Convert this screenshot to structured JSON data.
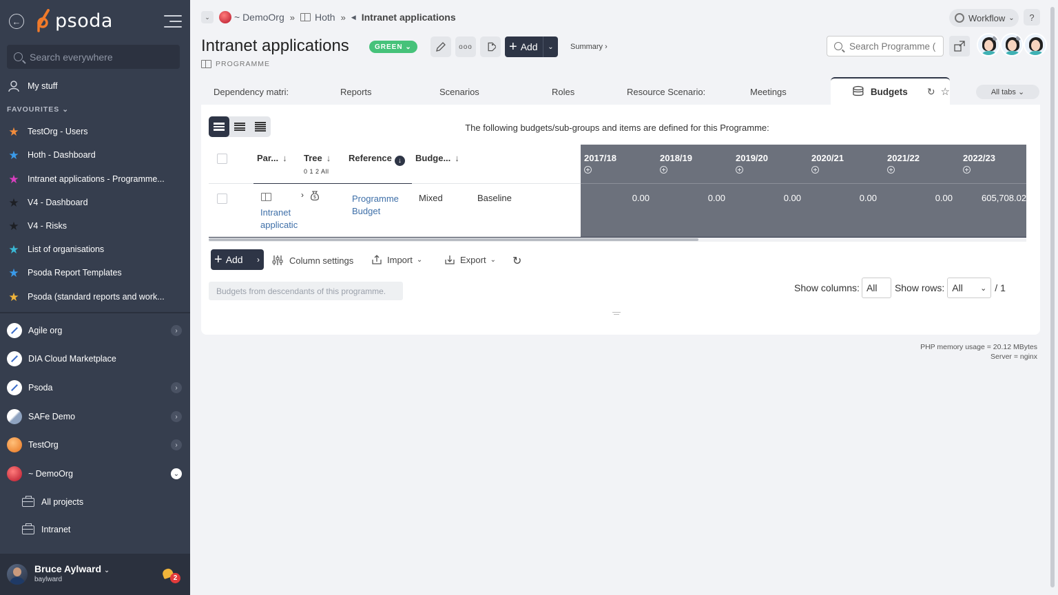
{
  "app": {
    "logo_text": "psoda",
    "brand_color": "#f07a2a"
  },
  "sidebar": {
    "search_placeholder": "Search everywhere",
    "my_stuff": "My stuff",
    "favourites_label": "FAVOURITES",
    "favourites": [
      {
        "label": "TestOrg - Users",
        "star_color": "#f28c3c"
      },
      {
        "label": "Hoth - Dashboard",
        "star_color": "#3a9bea"
      },
      {
        "label": "Intranet applications - Programme...",
        "star_color": "#d93fbf"
      },
      {
        "label": "V4 - Dashboard",
        "star_color": "#222222"
      },
      {
        "label": "V4 - Risks",
        "star_color": "#222222"
      },
      {
        "label": "List of organisations",
        "star_color": "#3ab8d6"
      },
      {
        "label": "Psoda Report Templates",
        "star_color": "#3a9bea"
      },
      {
        "label": "Psoda (standard reports and work...",
        "star_color": "#f0b43a"
      }
    ],
    "orgs": [
      {
        "label": "Agile org",
        "icon": "compass-icon"
      },
      {
        "label": "DIA Cloud Marketplace",
        "icon": "compass-icon"
      },
      {
        "label": "Psoda",
        "icon": "compass-icon"
      },
      {
        "label": "SAFe Demo",
        "icon": "safe-logo-icon"
      },
      {
        "label": "TestOrg",
        "icon": "orange-orb-icon"
      },
      {
        "label": "~ DemoOrg",
        "icon": "red-orb-icon"
      }
    ],
    "sub_items": [
      {
        "label": "All projects"
      },
      {
        "label": "Intranet"
      }
    ],
    "user": {
      "name": "Bruce Aylward",
      "login": "baylward",
      "notifications": "2"
    }
  },
  "breadcrumb": {
    "org": "~ DemoOrg",
    "portfolio": "Hoth",
    "current": "Intranet applications"
  },
  "header": {
    "title": "Intranet applications",
    "status": "GREEN",
    "status_color": "#46c27a",
    "type": "PROGRAMME",
    "add_label": "Add",
    "summary_label": "Summary ›",
    "workflow_label": "Workflow",
    "help_label": "?",
    "search_placeholder": "Search Programme (",
    "ellipsis_label": "ooo"
  },
  "tabs": {
    "items": [
      "Dependency matri:",
      "Reports",
      "Scenarios",
      "Roles",
      "Resource Scenario:",
      "Meetings"
    ],
    "active": "Budgets",
    "all_tabs": "All tabs"
  },
  "budgets": {
    "message": "The following budgets/sub-groups and items are defined for this Programme:",
    "columns": {
      "parent": "Par...",
      "tree": "Tree",
      "tree_levels": "0 1 2 All",
      "reference": "Reference",
      "budget": "Budge..."
    },
    "years": [
      "2017/18",
      "2018/19",
      "2019/20",
      "2020/21",
      "2021/22",
      "2022/23"
    ],
    "row": {
      "parent_line1": "Intranet",
      "parent_line2": "applicatic",
      "reference_line1": "Programme",
      "reference_line2": "Budget",
      "budget_type": "Mixed",
      "scenario": "Baseline",
      "values": [
        "0.00",
        "0.00",
        "0.00",
        "0.00",
        "0.00",
        "605,708.02"
      ]
    },
    "toolbar": {
      "add": "Add",
      "column_settings": "Column settings",
      "import": "Import",
      "export": "Export"
    },
    "descendants_label": "Budgets from descendants of this programme.",
    "show_columns_label": "Show columns:",
    "show_columns_value": "All",
    "show_rows_label": "Show rows:",
    "show_rows_value": "All",
    "page_total": "/ 1"
  },
  "footer": {
    "memory": "PHP memory usage = 20.12 MBytes",
    "server": "Server = nginx"
  }
}
